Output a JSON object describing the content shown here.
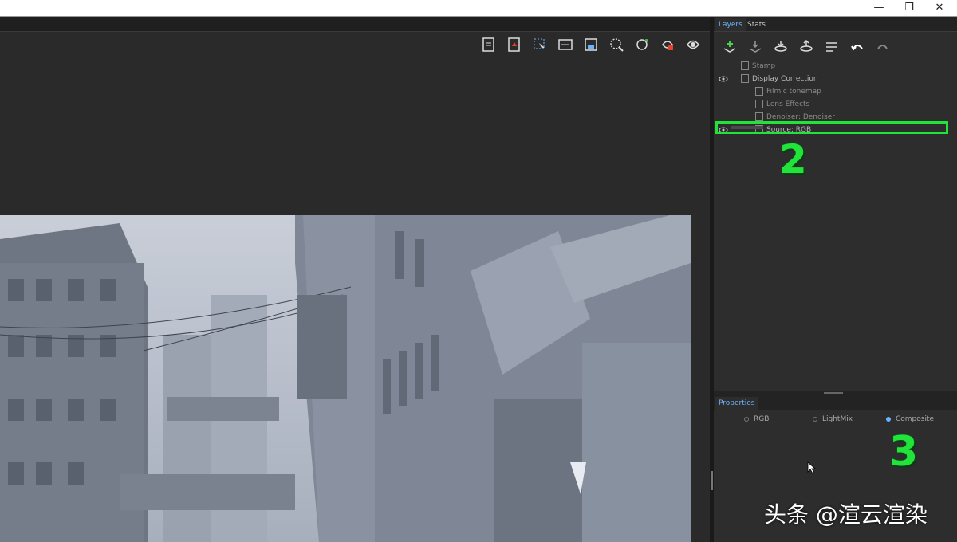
{
  "window": {
    "minimize": "—",
    "maximize": "❐",
    "close": "✕"
  },
  "viewport_toolbar": {
    "icons": [
      "save-image-icon",
      "export-pdf-icon",
      "select-region-icon",
      "ratio-icon",
      "frame-icon",
      "zoom-region-icon",
      "refresh-region-icon",
      "render-lock-icon",
      "render-icon"
    ]
  },
  "panel": {
    "tabs": [
      {
        "label": "Layers",
        "active": true
      },
      {
        "label": "Stats",
        "active": false
      }
    ],
    "toolbar_icons": [
      "add-layer-icon",
      "save-layer-icon",
      "load-layers-icon",
      "save-preset-icon",
      "list-icon",
      "undo-icon",
      "redo-icon"
    ],
    "layers": [
      {
        "name": "Stamp",
        "visible": false,
        "indent": 0
      },
      {
        "name": "Display Correction",
        "visible": true,
        "indent": 0
      },
      {
        "name": "Filmic tonemap",
        "visible": false,
        "indent": 1
      },
      {
        "name": "Lens Effects",
        "visible": false,
        "indent": 1
      },
      {
        "name": "Denoiser: Denoiser",
        "visible": false,
        "indent": 1
      },
      {
        "name": "Source: RGB",
        "visible": true,
        "indent": 1,
        "selected": true
      }
    ],
    "annotation_2": "2",
    "properties": {
      "tab": "Properties",
      "options": [
        {
          "label": "RGB",
          "selected": false
        },
        {
          "label": "LightMix",
          "selected": false
        },
        {
          "label": "Composite",
          "selected": true
        }
      ]
    },
    "annotation_3": "3"
  },
  "watermark": "头条 @渲云渲染",
  "colors": {
    "highlight": "#22e33a",
    "accent": "#6ab4ff",
    "panel_bg": "#2d2d2d"
  }
}
